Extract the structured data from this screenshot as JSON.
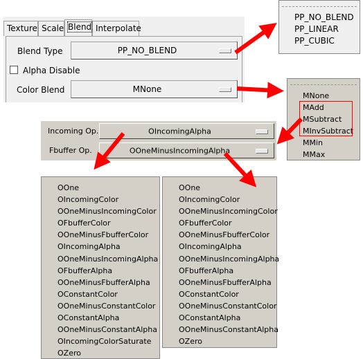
{
  "tabs": [
    "Texture",
    "Scale",
    "Blend",
    "Interpolate"
  ],
  "blend_type": {
    "label": "Blend Type",
    "value": "PP_NO_BLEND"
  },
  "alpha_disable": {
    "label": "Alpha Disable",
    "checked": false
  },
  "color_blend": {
    "label": "Color Blend",
    "value": "MNone"
  },
  "blend_type_options": [
    "PP_NO_BLEND",
    "PP_LINEAR",
    "PP_CUBIC"
  ],
  "color_blend_options": [
    "MNone",
    "MAdd",
    "MSubtract",
    "MInvSubtract",
    "MMin",
    "MMax"
  ],
  "incoming_op": {
    "label": "Incoming Op.",
    "value": "OIncomingAlpha"
  },
  "fbuffer_op": {
    "label": "Fbuffer Op.",
    "value": "OOneMinusIncomingAlpha"
  },
  "incoming_options": [
    "OOne",
    "OIncomingColor",
    "OOneMinusIncomingColor",
    "OFbufferColor",
    "OOneMinusFbufferColor",
    "OIncomingAlpha",
    "OOneMinusIncomingAlpha",
    "OFbufferAlpha",
    "OOneMinusFbufferAlpha",
    "OConstantColor",
    "OOneMinusConstantColor",
    "OConstantAlpha",
    "OOneMinusConstantAlpha",
    "OIncomingColorSaturate",
    "OZero"
  ],
  "fbuffer_options": [
    "OOne",
    "OIncomingColor",
    "OOneMinusIncomingColor",
    "OFbufferColor",
    "OOneMinusFbufferColor",
    "OIncomingAlpha",
    "OOneMinusIncomingAlpha",
    "OFbufferAlpha",
    "OOneMinusFbufferAlpha",
    "OConstantColor",
    "OOneMinusConstantColor",
    "OConstantAlpha",
    "OOneMinusConstantAlpha",
    "OZero"
  ],
  "colors": {
    "arrow": "#ff0000",
    "highlight_box": "#ff0000",
    "panel_light": "#f0f0f0",
    "panel_classic": "#d4d0c8"
  }
}
